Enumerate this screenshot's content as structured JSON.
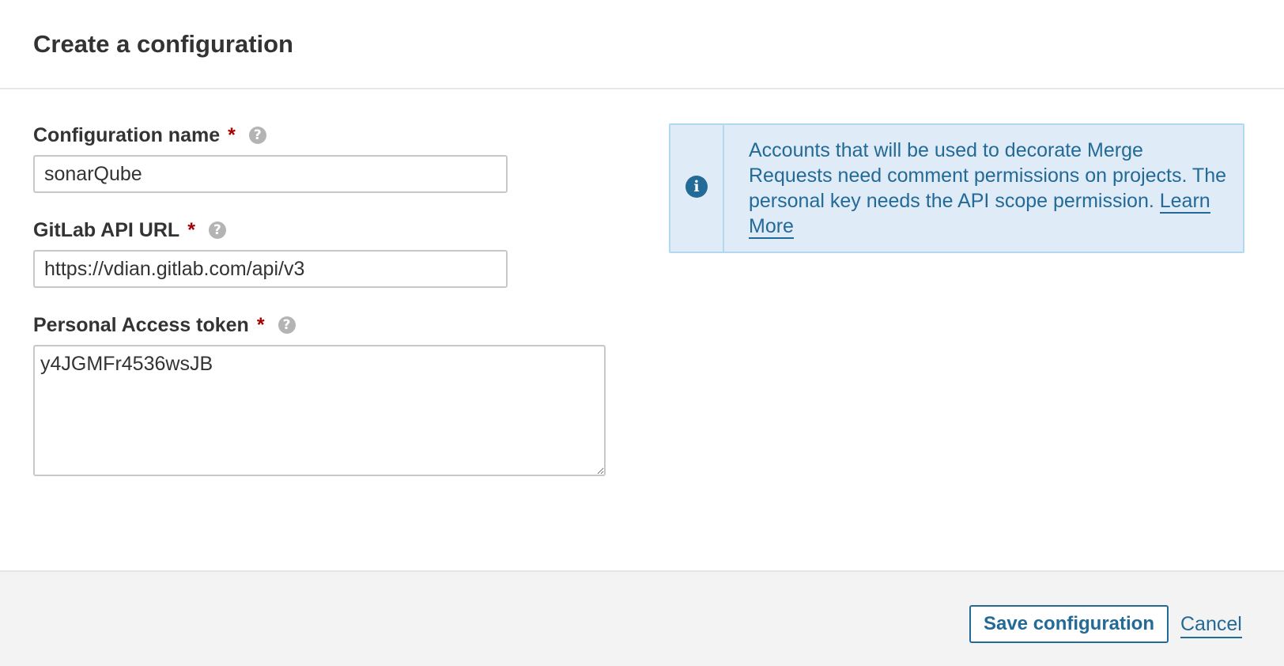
{
  "dialog": {
    "title": "Create a configuration"
  },
  "form": {
    "configuration_name": {
      "label": "Configuration name",
      "required_marker": "*",
      "value": "sonarQube"
    },
    "gitlab_api_url": {
      "label": "GitLab API URL",
      "required_marker": "*",
      "value": "https://vdian.gitlab.com/api/v3"
    },
    "personal_access_token": {
      "label": "Personal Access token",
      "required_marker": "*",
      "value": "y4JGMFr4536wsJB"
    },
    "help_glyph": "?"
  },
  "info_box": {
    "icon": "info-circle-icon",
    "text": "Accounts that will be used to decorate Merge Requests need comment permissions on projects. The personal key needs the API scope permission.",
    "link_label": "Learn More",
    "background_color": "#dfebf7",
    "border_color": "#b3d9f0",
    "text_color": "#236a97"
  },
  "footer": {
    "save_label": "Save configuration",
    "cancel_label": "Cancel"
  },
  "colors": {
    "accent": "#236a97",
    "required": "#a30000",
    "footer_background": "#f3f3f3"
  }
}
